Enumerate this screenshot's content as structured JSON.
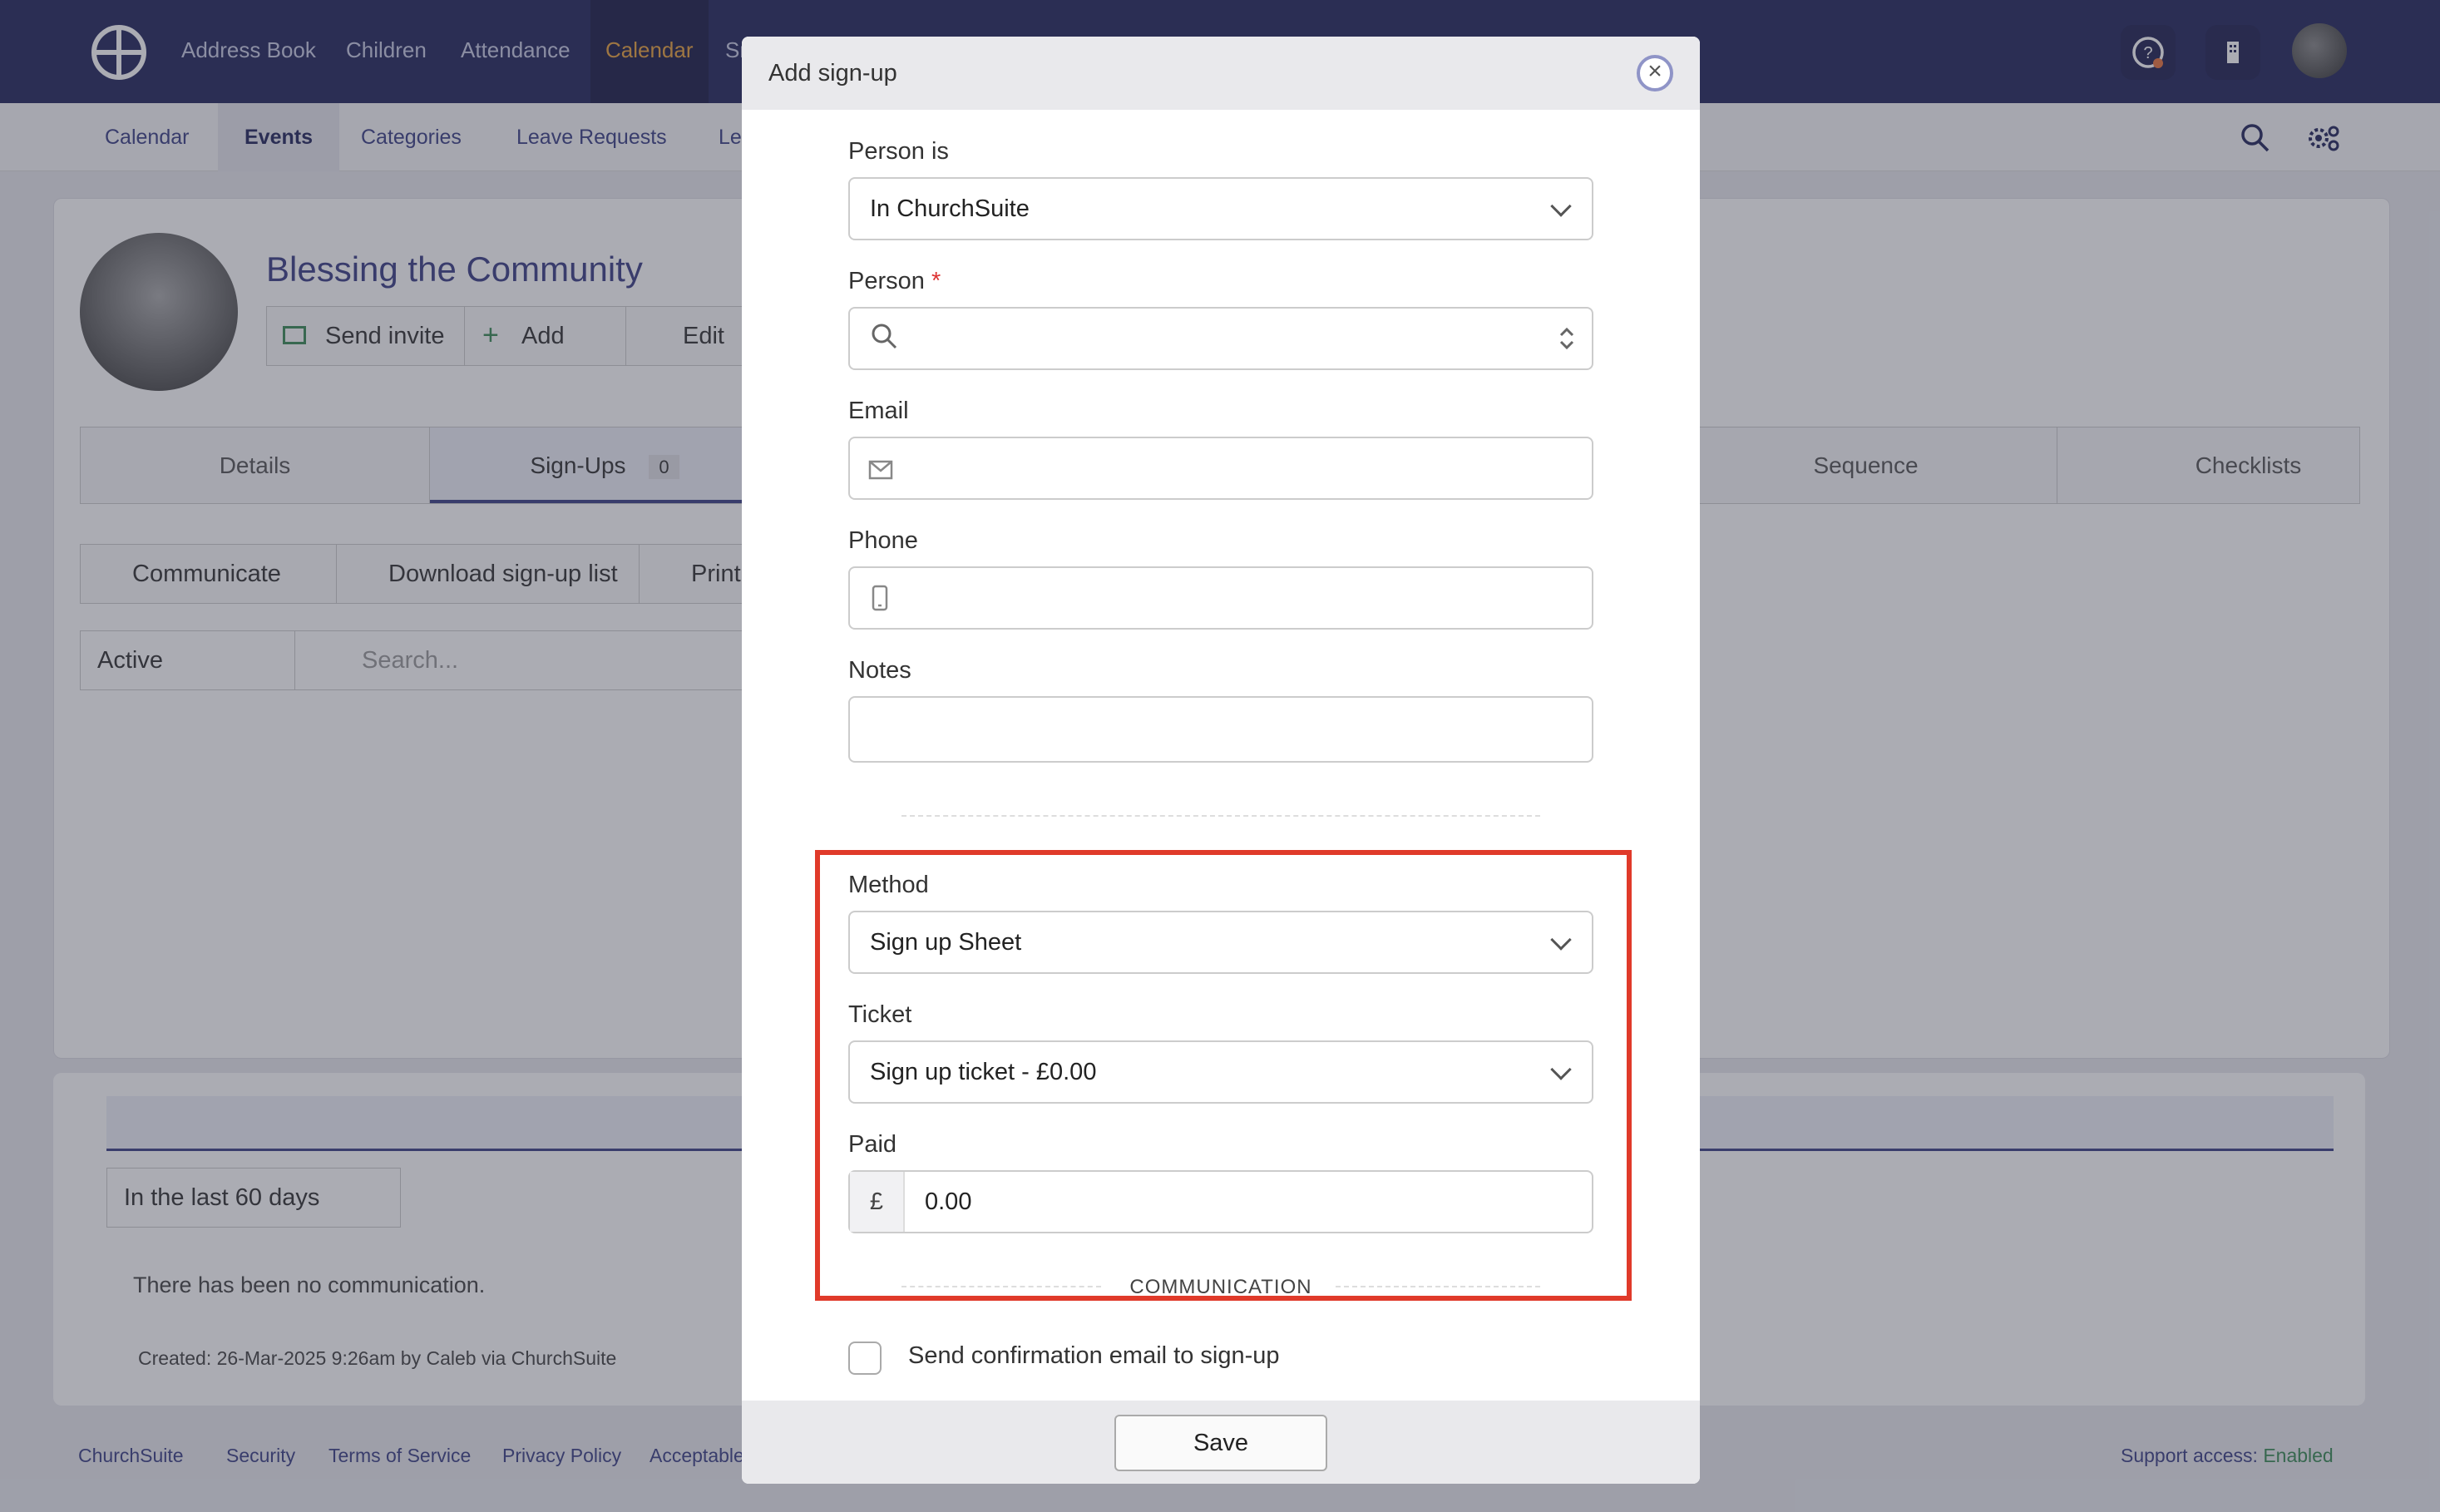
{
  "topnav": {
    "items": [
      "Address Book",
      "Children",
      "Attendance",
      "Calendar",
      "Sm"
    ],
    "active": "Calendar"
  },
  "subnav": {
    "items": [
      "Calendar",
      "Events",
      "Categories",
      "Leave Requests",
      "Le"
    ],
    "active": "Events"
  },
  "event": {
    "title": "Blessing the Community",
    "send_invite": "Send invite",
    "add": "Add",
    "edit": "Edit"
  },
  "tabs": {
    "details": "Details",
    "signups": "Sign-Ups",
    "signups_count": "0",
    "sequence": "Sequence",
    "checklists": "Checklists"
  },
  "toolbar": {
    "communicate": "Communicate",
    "download": "Download sign-up list",
    "print": "Print"
  },
  "filter": {
    "status": "Active",
    "search_placeholder": "Search..."
  },
  "communication": {
    "range": "In the last 60 days",
    "empty": "There has been no communication.",
    "created": "Created: 26-Mar-2025 9:26am by Caleb via ChurchSuite"
  },
  "footer": {
    "links": [
      "ChurchSuite",
      "Security",
      "Terms of Service",
      "Privacy Policy",
      "Acceptable"
    ],
    "support_label": "Support access:",
    "support_value": "Enabled"
  },
  "modal": {
    "title": "Add sign-up",
    "person_is_label": "Person is",
    "person_is_value": "In ChurchSuite",
    "person_label": "Person",
    "required_mark": "*",
    "email_label": "Email",
    "phone_label": "Phone",
    "notes_label": "Notes",
    "method_label": "Method",
    "method_value": "Sign up Sheet",
    "ticket_label": "Ticket",
    "ticket_value": "Sign up ticket - £0.00",
    "paid_label": "Paid",
    "currency_symbol": "£",
    "paid_value": "0.00",
    "communication_heading": "COMMUNICATION",
    "confirmation_label": "Send confirmation email to sign-up",
    "save_label": "Save"
  },
  "colors": {
    "nav_bg": "#23265c",
    "active_nav": "#e8a33d",
    "highlight": "#e03a2a",
    "link": "#3c4185"
  }
}
